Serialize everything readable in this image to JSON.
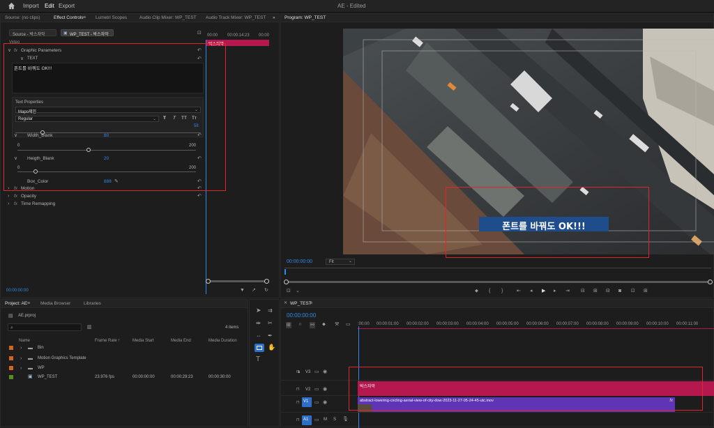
{
  "app": {
    "home_icon": "home-icon",
    "menu": {
      "import": "Import",
      "edit": "Edit",
      "export": "Export"
    },
    "title": "AE - Edited"
  },
  "source_tabs": {
    "source": "Source: (no clips)",
    "effect_controls": "Effect Controls",
    "lumetri": "Lumetri Scopes",
    "audio_clip": "Audio Clip Mixer: WP_TEST",
    "audio_track": "Audio Track Mixer: WP_TEST",
    "more": "»"
  },
  "effect_controls": {
    "source_chip": "Source - 박스자막",
    "seq_chip": "WP_TEST - 박스자막",
    "tc_start": "00:00",
    "tc_mid": "00:00:14:23",
    "tc_end": "00:00",
    "clip_label": "박스자막",
    "video_label": "Video",
    "graphic_params": "Graphic Parameters",
    "text_label": "TEXT",
    "text_value": "폰트를 바꿔도 OK!!!",
    "text_props": "Text Properties",
    "font": "Mapo제민",
    "style": "Regular",
    "style_buttons": [
      "T",
      "T",
      "TT",
      "Tт"
    ],
    "size_value": "58",
    "width_blank": "Width_Blank",
    "width_value": "80",
    "width_min": "0",
    "width_max": "200",
    "width_frac": 0.4,
    "height_blank": "Heigth_Blank",
    "height_value": "20",
    "height_min": "0",
    "height_max": "200",
    "height_frac": 0.1,
    "box_color": "Box_Color",
    "box_color_value": "888",
    "motion": "Motion",
    "opacity": "Opacity",
    "time_remap": "Time Remapping",
    "fx": "fx",
    "bottom_tc": "00:00:00:00"
  },
  "program": {
    "title": "Program: WP_TEST",
    "caption": "폰트를 바꿔도 OK!!!",
    "tc": "00:00:00:00",
    "fit": "Fit"
  },
  "project": {
    "tabs": {
      "project": "Project: AE",
      "media_browser": "Media Browser",
      "libraries": "Libraries"
    },
    "file": "AE.prproj",
    "items_count": "4 items",
    "columns": {
      "name": "Name",
      "frame_rate": "Frame Rate",
      "media_start": "Media Start",
      "media_end": "Media End",
      "media_duration": "Media Duration"
    },
    "rows": [
      {
        "name": "Bin",
        "color": "#d2641e",
        "type": "folder"
      },
      {
        "name": "Motion Graphics Template",
        "color": "#d2641e",
        "type": "folder"
      },
      {
        "name": "WP",
        "color": "#d2641e",
        "type": "folder"
      },
      {
        "name": "WP_TEST",
        "color": "#5b8a1e",
        "type": "sequence",
        "frame_rate": "23.976 fps",
        "media_start": "00:00:00:00",
        "media_end": "00:00:29:23",
        "media_duration": "00:00:30:00"
      }
    ]
  },
  "timeline": {
    "tab": "WP_TEST",
    "tc": "00:00:00:00",
    "ruler": [
      ":00:00",
      "00:00:01:00",
      "00:00:02:00",
      "00:00:03:00",
      "00:00:04:00",
      "00:00:05:00",
      "00:00:06:00",
      "00:00:07:00",
      "00:00:08:00",
      "00:00:09:00",
      "00:00:10:00",
      "00:00:11:00"
    ],
    "tracks": {
      "v3": "V3",
      "v2": "V2",
      "v1": "V1",
      "a1": "A1"
    },
    "clip_v2": "박스자막",
    "clip_v1": "abstract-lowering-circling-aerial-view-of-city-dow-2023-11-27-05-24-45-utc.mov",
    "fx": "fx",
    "m": "M",
    "s": "S"
  },
  "colors": {
    "accent": "#2d8ceb",
    "pink": "#b5184f",
    "purple": "#5f35b5",
    "red": "#e0252b"
  }
}
